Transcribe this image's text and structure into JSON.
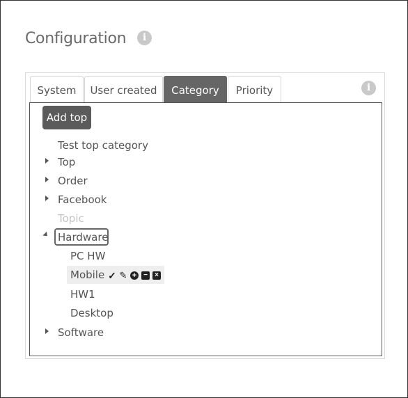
{
  "page": {
    "title": "Configuration",
    "info_icon": "info-icon"
  },
  "tabs": [
    {
      "label": "System",
      "active": false
    },
    {
      "label": "User created",
      "active": false
    },
    {
      "label": "Category",
      "active": true
    },
    {
      "label": "Priority",
      "active": false
    }
  ],
  "toolbar": {
    "add_top_label": "Add top"
  },
  "tree": {
    "nodes": [
      {
        "label": "Test top category",
        "expandable": false
      },
      {
        "label": "Top",
        "expandable": true,
        "expanded": false
      },
      {
        "label": "Order",
        "expandable": true,
        "expanded": false
      },
      {
        "label": "Facebook",
        "expandable": true,
        "expanded": false
      },
      {
        "label": "Topic",
        "expandable": false,
        "disabled": true
      },
      {
        "label": "Hardware",
        "expandable": true,
        "expanded": true,
        "focused": true,
        "children": [
          {
            "label": "PC HW"
          },
          {
            "label": "Mobile",
            "selected": true,
            "actions": [
              "check-icon",
              "pencil-icon",
              "add-circle-icon",
              "minus-square-icon",
              "close-square-icon"
            ]
          },
          {
            "label": "HW1"
          },
          {
            "label": "Desktop"
          }
        ]
      },
      {
        "label": "Software",
        "expandable": true,
        "expanded": false
      }
    ]
  },
  "colors": {
    "active_tab": "#666666",
    "button": "#5b5b5b",
    "text": "#555555",
    "disabled": "#c4c4c4"
  }
}
